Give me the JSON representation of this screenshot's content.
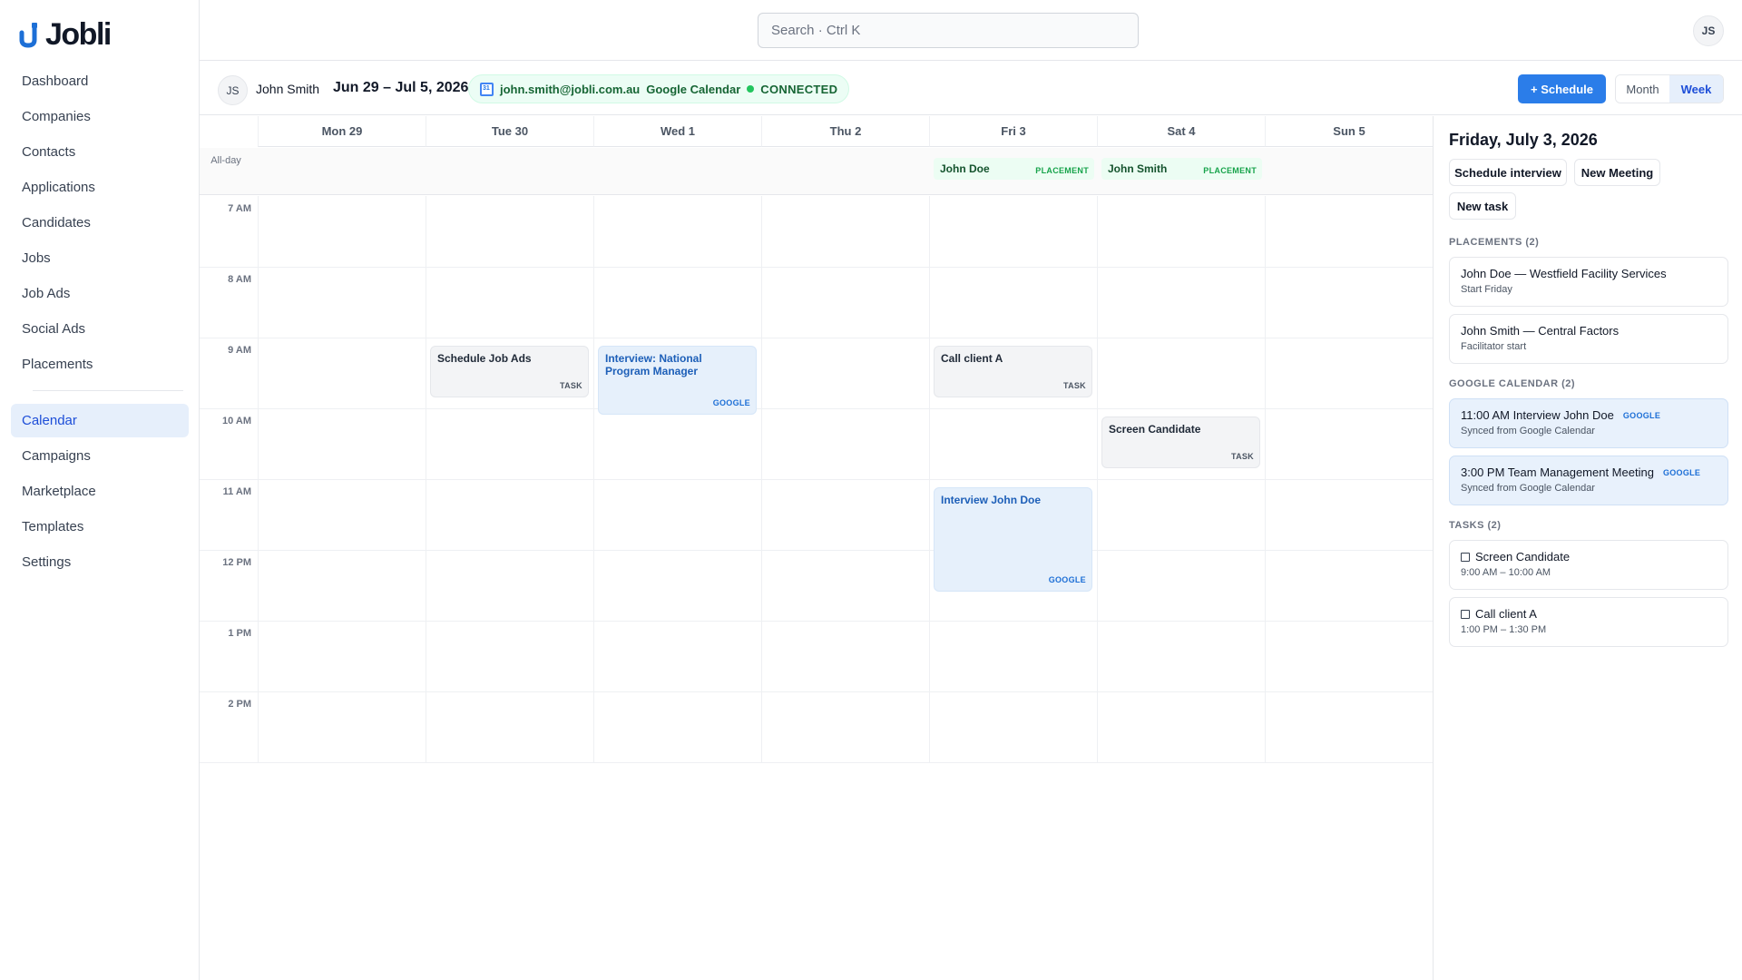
{
  "app": {
    "name": "Jobli"
  },
  "search": {
    "placeholder": "Search · Ctrl K"
  },
  "user": {
    "initials": "JS",
    "name": "John Smith"
  },
  "sidebar": {
    "items": [
      {
        "label": "Dashboard"
      },
      {
        "label": "Companies"
      },
      {
        "label": "Contacts"
      },
      {
        "label": "Applications"
      },
      {
        "label": "Candidates"
      },
      {
        "label": "Jobs"
      },
      {
        "label": "Job Ads"
      },
      {
        "label": "Social Ads"
      },
      {
        "label": "Placements"
      }
    ],
    "items2": [
      {
        "label": "Calendar",
        "active": true
      },
      {
        "label": "Campaigns"
      },
      {
        "label": "Marketplace"
      },
      {
        "label": "Templates"
      },
      {
        "label": "Settings"
      }
    ]
  },
  "calendar": {
    "range": "Jun 29 – Jul 5, 2026",
    "google": {
      "email": "john.smith@jobli.com.au",
      "label": "Google Calendar",
      "status": "CONNECTED"
    },
    "schedule_label": "+ Schedule",
    "views": [
      "Month",
      "Week"
    ],
    "active_view": "Week",
    "allday_label": "All-day",
    "days": [
      "Mon 29",
      "Tue 30",
      "Wed 1",
      "Thu 2",
      "Fri 3",
      "Sat 4",
      "Sun 5"
    ],
    "hours": [
      "7 AM",
      "8 AM",
      "9 AM",
      "10 AM",
      "11 AM",
      "12 PM",
      "1 PM",
      "2 PM"
    ],
    "allday_events": [
      {
        "day": 4,
        "title": "John Doe",
        "tag": "PLACEMENT"
      },
      {
        "day": 5,
        "title": "John Smith",
        "tag": "PLACEMENT"
      }
    ],
    "events": [
      {
        "day": 1,
        "start": 9,
        "end": 9.75,
        "title": "Schedule Job Ads",
        "tag": "TASK",
        "kind": "task"
      },
      {
        "day": 2,
        "start": 9,
        "end": 10,
        "title": "Interview: National Program Manager",
        "tag": "GOOGLE",
        "kind": "google"
      },
      {
        "day": 4,
        "start": 9,
        "end": 9.75,
        "title": "Call client A",
        "tag": "TASK",
        "kind": "task"
      },
      {
        "day": 5,
        "start": 10,
        "end": 10.75,
        "title": "Screen Candidate",
        "tag": "TASK",
        "kind": "task"
      },
      {
        "day": 4,
        "start": 11,
        "end": 12.5,
        "title": "Interview John Doe",
        "tag": "GOOGLE",
        "kind": "google"
      }
    ]
  },
  "panel": {
    "date_title": "Friday, July 3, 2026",
    "buttons": {
      "schedule_interview": "Schedule interview",
      "new_meeting": "New Meeting",
      "new_task": "New task"
    },
    "placements_title": "PLACEMENTS (2)",
    "placements": [
      {
        "title": "John Doe — Westfield Facility Services",
        "sub": "Start Friday"
      },
      {
        "title": "John Smith — Central Factors",
        "sub": "Facilitator start"
      }
    ],
    "google_title": "GOOGLE CALENDAR (2)",
    "google_events": [
      {
        "title": "11:00 AM Interview John Doe",
        "tag": "GOOGLE",
        "sub": "Synced from Google Calendar"
      },
      {
        "title": "3:00 PM Team Management Meeting",
        "tag": "GOOGLE",
        "sub": "Synced from Google Calendar"
      }
    ],
    "tasks_title": "TASKS (2)",
    "tasks": [
      {
        "title": "Screen Candidate",
        "sub": "9:00 AM – 10:00 AM"
      },
      {
        "title": "Call client A",
        "sub": "1:00 PM – 1:30 PM"
      }
    ]
  },
  "colors": {
    "accent": "#2b7de9",
    "active_bg": "#e6effb",
    "google_bg": "#e6f0fb",
    "placement_bg": "#ecfdf3",
    "connected": "#22c55e"
  }
}
